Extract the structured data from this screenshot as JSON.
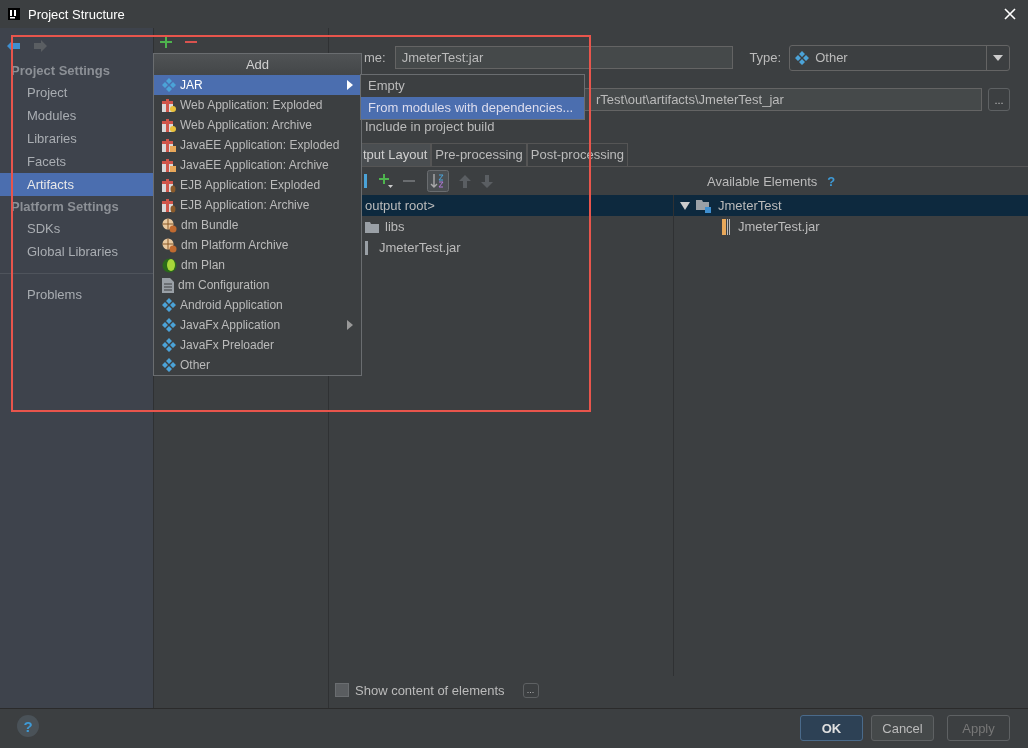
{
  "window": {
    "title": "Project Structure"
  },
  "sidebar": {
    "groups": [
      {
        "heading": "Project Settings",
        "items": [
          {
            "label": "Project",
            "selected": false
          },
          {
            "label": "Modules",
            "selected": false
          },
          {
            "label": "Libraries",
            "selected": false
          },
          {
            "label": "Facets",
            "selected": false
          },
          {
            "label": "Artifacts",
            "selected": true
          }
        ]
      },
      {
        "heading": "Platform Settings",
        "items": [
          {
            "label": "SDKs",
            "selected": false
          },
          {
            "label": "Global Libraries",
            "selected": false
          }
        ]
      }
    ],
    "extra_items": [
      {
        "label": "Problems",
        "selected": false
      }
    ]
  },
  "add_menu": {
    "title": "Add",
    "items": [
      {
        "label": "JAR",
        "kind": "diamond",
        "selected": true,
        "submenu": true
      },
      {
        "label": "Web Application: Exploded",
        "kind": "web",
        "selected": false,
        "submenu": false
      },
      {
        "label": "Web Application: Archive",
        "kind": "web",
        "selected": false,
        "submenu": false
      },
      {
        "label": "JavaEE Application: Exploded",
        "kind": "javaee",
        "selected": false,
        "submenu": false
      },
      {
        "label": "JavaEE Application: Archive",
        "kind": "javaee",
        "selected": false,
        "submenu": false
      },
      {
        "label": "EJB Application: Exploded",
        "kind": "ejb",
        "selected": false,
        "submenu": false
      },
      {
        "label": "EJB Application: Archive",
        "kind": "ejb",
        "selected": false,
        "submenu": false
      },
      {
        "label": "dm Bundle",
        "kind": "bundle",
        "selected": false,
        "submenu": false
      },
      {
        "label": "dm Platform Archive",
        "kind": "bundle",
        "selected": false,
        "submenu": false
      },
      {
        "label": "dm Plan",
        "kind": "plan",
        "selected": false,
        "submenu": false
      },
      {
        "label": "dm Configuration",
        "kind": "config",
        "selected": false,
        "submenu": false
      },
      {
        "label": "Android Application",
        "kind": "diamond",
        "selected": false,
        "submenu": false
      },
      {
        "label": "JavaFx Application",
        "kind": "diamond",
        "selected": false,
        "submenu": true
      },
      {
        "label": "JavaFx Preloader",
        "kind": "diamond",
        "selected": false,
        "submenu": false
      },
      {
        "label": "Other",
        "kind": "diamond",
        "selected": false,
        "submenu": false
      }
    ]
  },
  "submenu": {
    "items": [
      {
        "label": "Empty",
        "selected": false
      },
      {
        "label": "From modules with dependencies...",
        "selected": true
      }
    ]
  },
  "artifact": {
    "name_label": "me:",
    "name_value": "JmeterTest:jar",
    "type_label": "Type:",
    "type_value": "Other",
    "output_path": "rTest\\out\\artifacts\\JmeterTest_jar",
    "browse_button": "...",
    "include_label": "Include in project build"
  },
  "tabs": [
    {
      "label": "tput Layout",
      "selected": true
    },
    {
      "label": "Pre-processing",
      "selected": false
    },
    {
      "label": "Post-processing",
      "selected": false
    }
  ],
  "layout": {
    "available_label": "Available Elements",
    "help": "?",
    "left_tree": [
      {
        "label": "output root>",
        "kind": "plain",
        "selected": true
      },
      {
        "label": "libs",
        "kind": "folder",
        "selected": false
      },
      {
        "label": "JmeterTest.jar",
        "kind": "jar",
        "selected": false
      }
    ],
    "right_tree": [
      {
        "label": "JmeterTest",
        "expanded": true,
        "selected": true,
        "children": [
          {
            "label": "JmeterTest.jar"
          }
        ]
      }
    ],
    "show_content": {
      "label": "Show content of elements",
      "checked": false
    },
    "more_button": "..."
  },
  "footer": {
    "help": "?",
    "buttons": [
      {
        "label": "OK",
        "kind": "primary"
      },
      {
        "label": "Cancel",
        "kind": "normal"
      },
      {
        "label": "Apply",
        "kind": "disabled"
      }
    ]
  }
}
